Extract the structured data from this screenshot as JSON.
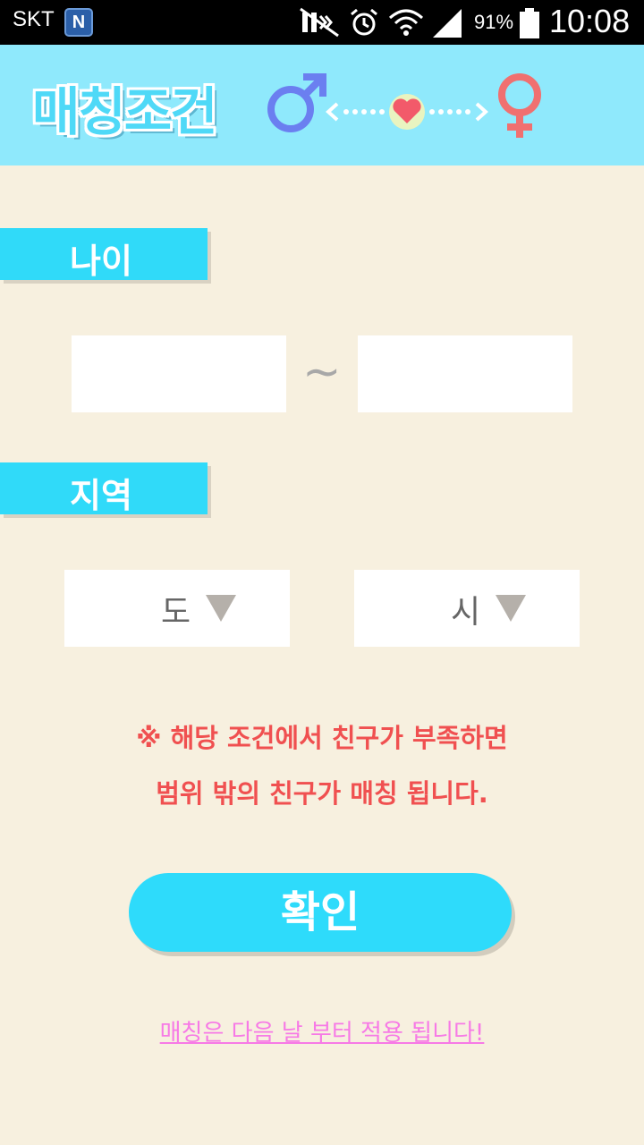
{
  "status_bar": {
    "carrier": "SKT",
    "app_badge": "N",
    "battery_percent": "91%",
    "time": "10:08",
    "icons": [
      "mute-icon",
      "alarm-icon",
      "wifi-icon",
      "signal-icon",
      "battery-icon"
    ]
  },
  "header": {
    "title": "매칭조건",
    "male_symbol": "♂",
    "female_symbol": "♀",
    "heart": "♥"
  },
  "age_section": {
    "label": "나이",
    "separator": "~",
    "min_value": "",
    "max_value": ""
  },
  "region_section": {
    "label": "지역",
    "province_value": "도",
    "city_value": "시"
  },
  "notice": {
    "line1": "※ 해당 조건에서 친구가 부족하면",
    "line2": "범위 밖의 친구가 매칭 됩니다."
  },
  "confirm_button": {
    "label": "확인"
  },
  "footnote": {
    "text": "매칭은 다음 날 부터 적용 됩니다!"
  },
  "colors": {
    "background": "#f7f0df",
    "header": "#8fe9fc",
    "accent": "#30daf9",
    "notice": "#f05050",
    "footnote": "#f77ae6",
    "male": "#6b7ff0",
    "female": "#f07070"
  }
}
